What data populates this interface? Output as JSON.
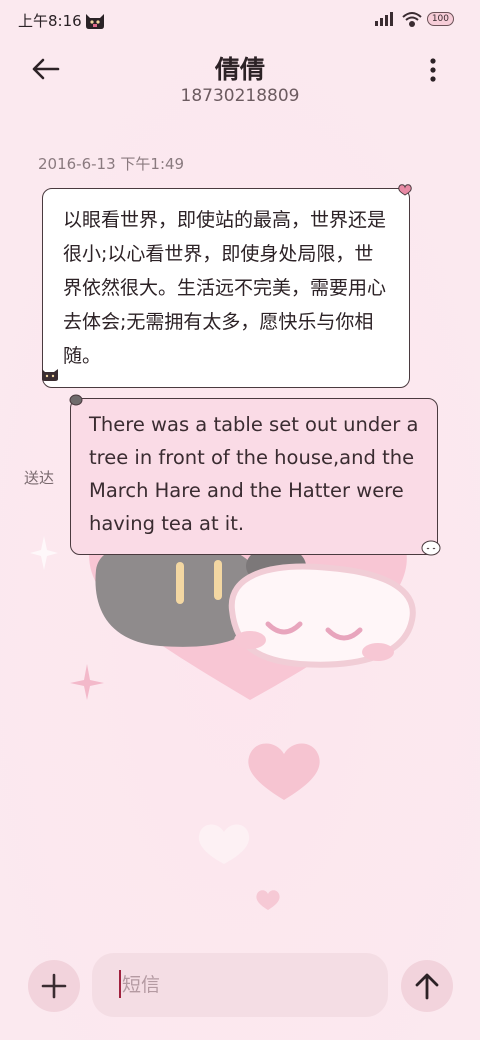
{
  "status_bar": {
    "time": "上午8:16",
    "battery": "100",
    "icons": [
      "cat-icon",
      "signal-icon",
      "wifi-icon",
      "battery-icon"
    ]
  },
  "header": {
    "contact_name": "倩倩",
    "phone_number": "18730218809",
    "back_icon": "arrow-left-icon",
    "more_icon": "more-vertical-icon"
  },
  "conversation": {
    "timestamp": "2016-6-13 下午1:49",
    "incoming_message": "以眼看世界，即使站的最高，世界还是很小;以心看世界，即使身处局限，世界依然很大。生活远不完美，需要用心去体会;无需拥有太多，愿快乐与你相随。",
    "outgoing_message": "There was a table set out under a tree in front of the house,and the March Hare and the Hatter were having tea at it.",
    "delivery_status": "送达"
  },
  "composer": {
    "placeholder": "短信",
    "value": "",
    "add_icon": "plus-icon",
    "send_icon": "arrow-up-icon"
  },
  "colors": {
    "background": "#fbe9ef",
    "incoming_bubble": "#ffffff",
    "outgoing_bubble": "#fadbe6",
    "caret": "#a0213e"
  }
}
